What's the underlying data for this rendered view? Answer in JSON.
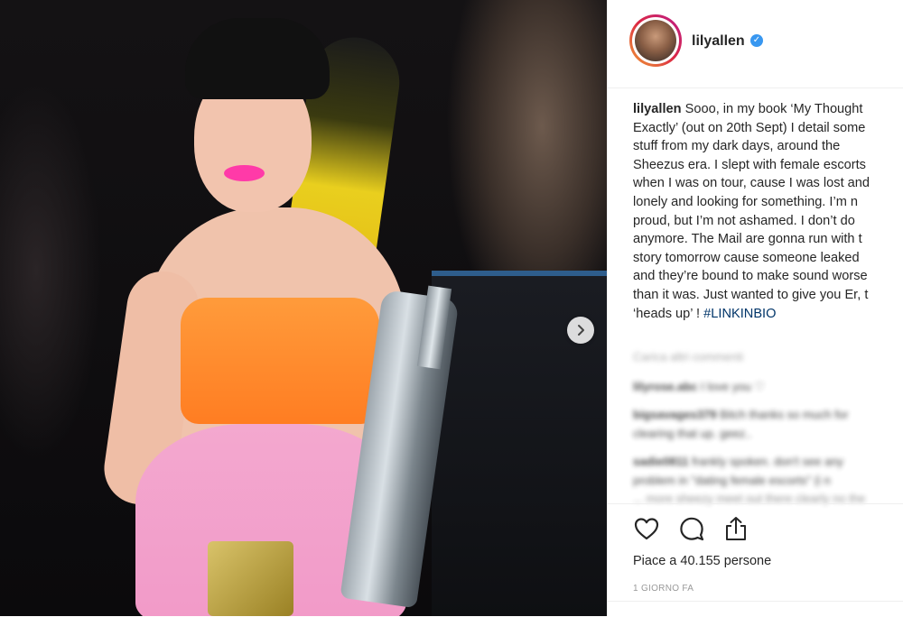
{
  "post": {
    "username": "lilyallen",
    "caption_lines": [
      "Sooo, in my book ‘My Thought",
      "Exactly’ (out on 20th Sept) I detail some",
      "stuff from my dark days, around the",
      "Sheezus era. I slept with female escorts",
      "when I was on tour, cause I was lost and",
      "lonely and looking for something. I’m n",
      "proud, but I’m not ashamed. I don’t do",
      "anymore. The Mail are gonna run with t",
      "story tomorrow cause someone leaked",
      "and they’re bound to make sound worse",
      "than it was. Just wanted to give you Er, t",
      "‘heads up’ !"
    ],
    "hashtag": "#LINKINBIO",
    "load_comments": "Carica altri commenti",
    "comments": [
      {
        "user": "lilyrose.abc",
        "text": "I love you ♡"
      },
      {
        "user": "bigsavages379",
        "text": "Bitch thanks so much for"
      },
      {
        "user": "",
        "text": "clearing that up. geez.."
      },
      {
        "user": "sadie0811",
        "text": "frankly spoken. don't see any"
      },
      {
        "user": "",
        "text": "problem in \"dating female escorts\" (i n"
      },
      {
        "user": "",
        "text": "... more sheezy meet out there clearly no the"
      }
    ],
    "likes": "Piace a 40.155 persone",
    "timestamp": "1 GIORNO FA"
  },
  "icons": {
    "verified": "verified-badge-icon",
    "next": "chevron-right-icon",
    "like": "heart-icon",
    "comment": "comment-icon",
    "share": "share-icon"
  },
  "colors": {
    "verified": "#3897f0",
    "hashtag": "#003569",
    "text": "#262626",
    "muted": "#999999"
  }
}
